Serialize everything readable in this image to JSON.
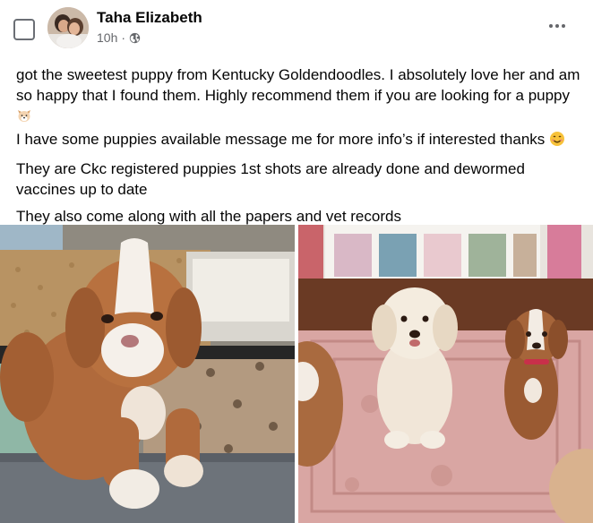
{
  "post": {
    "author": "Taha Elizabeth",
    "time": "10h",
    "separator": "·",
    "privacy_icon": "globe-icon",
    "more_icon": "more-horizontal-icon",
    "paragraphs": [
      "got the sweetest puppy from Kentucky Goldendoodles. I absolutely love her and am so happy that I found them. Highly recommend them if you are looking for a puppy",
      "I have some puppies available message me for more info’s if interested thanks",
      "They are Ckc registered puppies 1st shots are already done and dewormed vaccines up to date",
      "They also come along with all the papers and vet records"
    ],
    "emojis": [
      "dog-face-emoji",
      "smiling-face-emoji"
    ]
  },
  "photos": [
    {
      "name": "puppy-in-whelping-box-photo"
    },
    {
      "name": "goldendoodle-puppies-on-rug-photo"
    }
  ],
  "colors": {
    "text": "#050505",
    "secondary_text": "#65676b",
    "background": "#ffffff"
  }
}
